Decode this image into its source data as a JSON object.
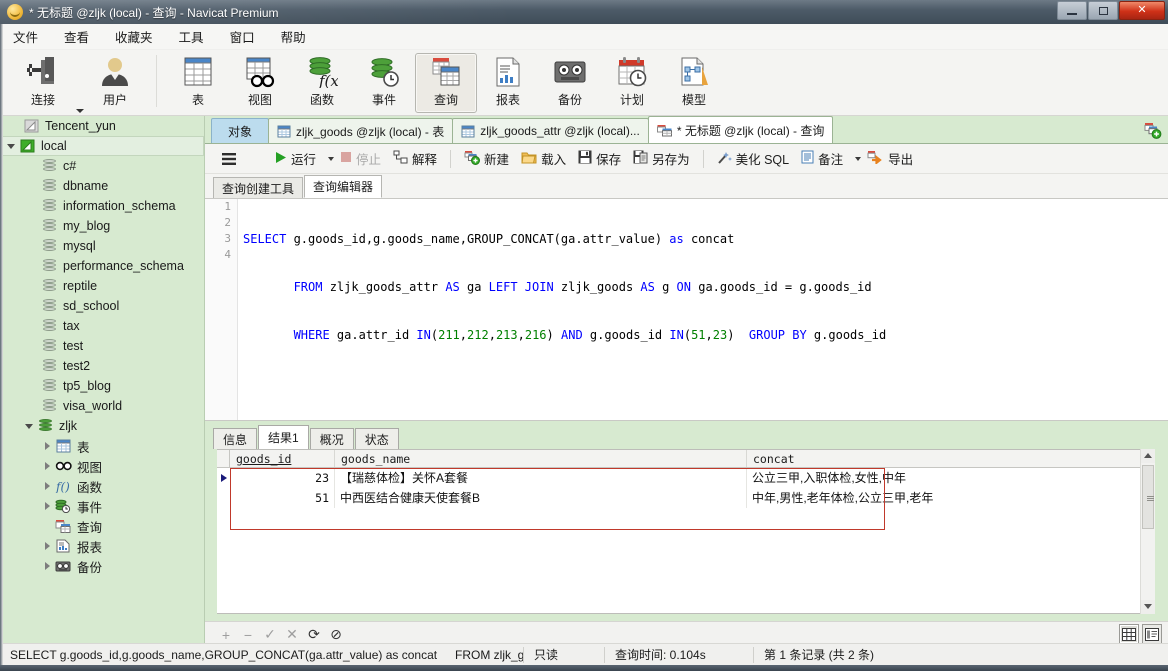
{
  "window": {
    "title": "* 无标题 @zljk (local) - 查询 - Navicat Premium",
    "minimize_label": "最小化",
    "maximize_label": "最大化",
    "close_label": "✕"
  },
  "menubar": {
    "items": [
      {
        "label": "文件",
        "name": "menu-file"
      },
      {
        "label": "查看",
        "name": "menu-view"
      },
      {
        "label": "收藏夹",
        "name": "menu-favorites"
      },
      {
        "label": "工具",
        "name": "menu-tools"
      },
      {
        "label": "窗口",
        "name": "menu-window"
      },
      {
        "label": "帮助",
        "name": "menu-help"
      }
    ]
  },
  "toolbar": {
    "items": [
      {
        "label": "连接",
        "icon": "connection-icon",
        "name": "toolbar-connection",
        "dropdown": true
      },
      {
        "label": "用户",
        "icon": "user-icon",
        "name": "toolbar-user"
      },
      {
        "label": "表",
        "icon": "table-icon",
        "name": "toolbar-table"
      },
      {
        "label": "视图",
        "icon": "view-icon",
        "name": "toolbar-view"
      },
      {
        "label": "函数",
        "icon": "function-icon",
        "name": "toolbar-function"
      },
      {
        "label": "事件",
        "icon": "event-icon",
        "name": "toolbar-event"
      },
      {
        "label": "查询",
        "icon": "query-icon",
        "name": "toolbar-query",
        "active": true
      },
      {
        "label": "报表",
        "icon": "report-icon",
        "name": "toolbar-report"
      },
      {
        "label": "备份",
        "icon": "backup-icon",
        "name": "toolbar-backup"
      },
      {
        "label": "计划",
        "icon": "schedule-icon",
        "name": "toolbar-schedule"
      },
      {
        "label": "模型",
        "icon": "model-icon",
        "name": "toolbar-model"
      }
    ]
  },
  "sidebar": {
    "items": [
      {
        "label": "Tencent_yun",
        "indent": 1,
        "icon": "connection-gray-icon",
        "twisty": "none",
        "selected": false
      },
      {
        "label": "local",
        "indent": 0,
        "icon": "connection-green-icon",
        "twisty": "down",
        "selected": true
      },
      {
        "label": "c#",
        "indent": 2,
        "icon": "db-gray-icon",
        "twisty": "none"
      },
      {
        "label": "dbname",
        "indent": 2,
        "icon": "db-gray-icon",
        "twisty": "none"
      },
      {
        "label": "information_schema",
        "indent": 2,
        "icon": "db-gray-icon",
        "twisty": "none"
      },
      {
        "label": "my_blog",
        "indent": 2,
        "icon": "db-gray-icon",
        "twisty": "none"
      },
      {
        "label": "mysql",
        "indent": 2,
        "icon": "db-gray-icon",
        "twisty": "none"
      },
      {
        "label": "performance_schema",
        "indent": 2,
        "icon": "db-gray-icon",
        "twisty": "none"
      },
      {
        "label": "reptile",
        "indent": 2,
        "icon": "db-gray-icon",
        "twisty": "none"
      },
      {
        "label": "sd_school",
        "indent": 2,
        "icon": "db-gray-icon",
        "twisty": "none"
      },
      {
        "label": "tax",
        "indent": 2,
        "icon": "db-gray-icon",
        "twisty": "none"
      },
      {
        "label": "test",
        "indent": 2,
        "icon": "db-gray-icon",
        "twisty": "none"
      },
      {
        "label": "test2",
        "indent": 2,
        "icon": "db-gray-icon",
        "twisty": "none"
      },
      {
        "label": "tp5_blog",
        "indent": 2,
        "icon": "db-gray-icon",
        "twisty": "none"
      },
      {
        "label": "visa_world",
        "indent": 2,
        "icon": "db-gray-icon",
        "twisty": "none"
      },
      {
        "label": "zljk",
        "indent": 1,
        "icon": "db-green-icon",
        "twisty": "down"
      },
      {
        "label": "表",
        "indent": 3,
        "icon": "table-icon",
        "twisty": "right"
      },
      {
        "label": "视图",
        "indent": 3,
        "icon": "view-icon",
        "twisty": "right"
      },
      {
        "label": "函数",
        "indent": 3,
        "icon": "function-icon",
        "twisty": "right"
      },
      {
        "label": "事件",
        "indent": 3,
        "icon": "event-icon",
        "twisty": "right"
      },
      {
        "label": "查询",
        "indent": 3,
        "icon": "query-icon",
        "twisty": "none"
      },
      {
        "label": "报表",
        "indent": 3,
        "icon": "report-icon",
        "twisty": "right"
      },
      {
        "label": "备份",
        "indent": 3,
        "icon": "backup-icon",
        "twisty": "right"
      }
    ]
  },
  "tabs": {
    "object_tab": "对象",
    "items": [
      {
        "label": "zljk_goods @zljk (local) - 表",
        "icon": "table-icon",
        "active": false
      },
      {
        "label": "zljk_goods_attr @zljk (local)...",
        "icon": "table-icon",
        "active": false
      },
      {
        "label": "* 无标题 @zljk (local) - 查询",
        "icon": "query-icon",
        "active": true
      }
    ],
    "new_tab_label": "新建查询"
  },
  "query_toolbar": {
    "menu_label": "≡",
    "buttons": [
      {
        "label": "运行",
        "icon": "play-icon",
        "dropdown": true,
        "disabled": false,
        "name": "run-button"
      },
      {
        "label": "停止",
        "icon": "stop-icon",
        "disabled": true,
        "name": "stop-button"
      },
      {
        "label": "解释",
        "icon": "explain-icon",
        "disabled": false,
        "name": "explain-button"
      },
      {
        "label": "新建",
        "icon": "new-icon",
        "disabled": false,
        "name": "new-button"
      },
      {
        "label": "载入",
        "icon": "load-icon",
        "disabled": false,
        "name": "load-button"
      },
      {
        "label": "保存",
        "icon": "save-icon",
        "disabled": false,
        "name": "save-button"
      },
      {
        "label": "另存为",
        "icon": "save-as-icon",
        "disabled": false,
        "name": "save-as-button"
      },
      {
        "label": "美化 SQL",
        "icon": "beautify-icon",
        "disabled": false,
        "name": "beautify-button"
      },
      {
        "label": "备注",
        "icon": "comment-icon",
        "dropdown": true,
        "disabled": false,
        "name": "comment-button"
      },
      {
        "label": "导出",
        "icon": "export-icon",
        "disabled": false,
        "name": "export-button"
      }
    ]
  },
  "editor": {
    "subtabs": [
      {
        "label": "查询创建工具",
        "active": false
      },
      {
        "label": "查询编辑器",
        "active": true
      }
    ],
    "line_numbers": [
      "1",
      "2",
      "3",
      "4"
    ],
    "sql_lines": [
      "SELECT g.goods_id,g.goods_name,GROUP_CONCAT(ga.attr_value) as concat",
      "       FROM zljk_goods_attr AS ga LEFT JOIN zljk_goods AS g ON ga.goods_id = g.goods_id",
      "       WHERE ga.attr_id IN(211,212,213,216) AND g.goods_id IN(51,23)  GROUP BY g.goods_id",
      ""
    ]
  },
  "results": {
    "tabs": [
      {
        "label": "信息",
        "active": false
      },
      {
        "label": "结果1",
        "active": true
      },
      {
        "label": "概况",
        "active": false
      },
      {
        "label": "状态",
        "active": false
      }
    ],
    "columns": [
      "goods_id",
      "goods_name",
      "concat"
    ],
    "sorted_column": "goods_id",
    "rows": [
      {
        "goods_id": "23",
        "goods_name": "【瑞慈体检】关怀A套餐",
        "concat": "公立三甲,入职体检,女性,中年",
        "current": true
      },
      {
        "goods_id": "51",
        "goods_name": "中西医结合健康天使套餐B",
        "concat": "中年,男性,老年体检,公立三甲,老年",
        "current": false
      }
    ],
    "selection_color": "#c0392b"
  },
  "grid_toolbar": {
    "buttons": [
      {
        "icon": "plus-icon",
        "enabled": false,
        "name": "add-record-button"
      },
      {
        "icon": "minus-icon",
        "enabled": false,
        "name": "delete-record-button"
      },
      {
        "icon": "check-icon",
        "enabled": false,
        "name": "apply-change-button"
      },
      {
        "icon": "cross-icon",
        "enabled": false,
        "name": "cancel-change-button"
      },
      {
        "icon": "refresh-icon",
        "enabled": true,
        "name": "refresh-button"
      },
      {
        "icon": "stop-circle-icon",
        "enabled": true,
        "name": "stop-loading-button"
      }
    ],
    "view_modes": [
      {
        "icon": "grid-view-icon",
        "selected": true,
        "name": "grid-view-button"
      },
      {
        "icon": "form-view-icon",
        "selected": false,
        "name": "form-view-button"
      }
    ]
  },
  "statusbar": {
    "sql_left": "SELECT g.goods_id,g.goods_name,GROUP_CONCAT(ga.attr_value) as concat",
    "sql_right": "FROM zljk_g",
    "readonly": "只读",
    "query_time": "查询时间: 0.104s",
    "record_info": "第 1 条记录 (共 2 条)"
  }
}
